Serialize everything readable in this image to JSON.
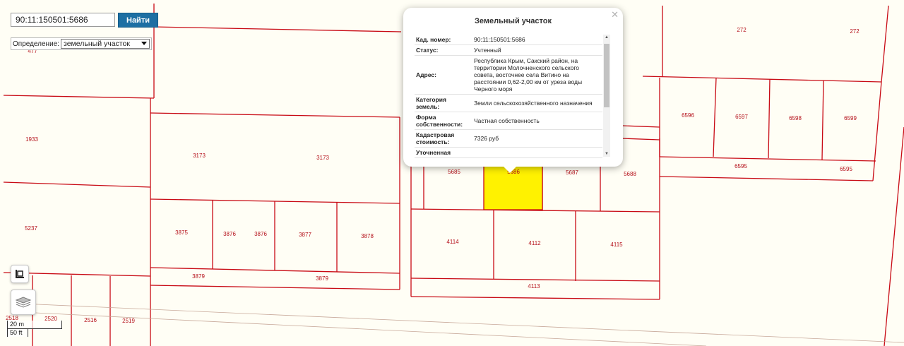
{
  "search": {
    "value": "90:11:150501:5686",
    "button_label": "Найти"
  },
  "determine": {
    "label": "Определение:",
    "selected": "земельный участок"
  },
  "map": {
    "background": "#fffef5",
    "line_color": "#c80a14",
    "selected_fill": "#fff200",
    "parcels": [
      "477",
      "1933",
      "5237",
      "3173",
      "3173",
      "3875",
      "3876",
      "3876",
      "3877",
      "3878",
      "3879",
      "3879",
      "2518",
      "2520",
      "2516",
      "2519",
      "5685",
      "5686",
      "5687",
      "5688",
      "4114",
      "4112",
      "4115",
      "4113",
      "272",
      "272",
      "6596",
      "6597",
      "6598",
      "6599",
      "6595",
      "6595"
    ],
    "selected_parcel": "5686"
  },
  "scale": {
    "metric": "20 m",
    "imperial": "50 ft"
  },
  "popup": {
    "title": "Земельный участок",
    "rows": [
      {
        "key": "Кад. номер:",
        "value": "90:11:150501:5686"
      },
      {
        "key": "Статус:",
        "value": "Учтенный"
      },
      {
        "key": "Адрес:",
        "value": "Республика Крым, Сакский район, на территории Молочненского сельского совета, восточнее села Витино на расстоянии 0,62-2,00 км от уреза воды Черного моря"
      },
      {
        "key": "Категория земель:",
        "value": "Земли сельскохозяйственного назначения"
      },
      {
        "key": "Форма собственности:",
        "value": "Частная собственность"
      },
      {
        "key": "Кадастровая стоимость:",
        "value": "7326 руб"
      },
      {
        "key": "Уточненная",
        "value": ""
      }
    ]
  },
  "icons": {
    "close": "close-icon",
    "layers": "layers-icon",
    "ruler": "ruler-icon"
  }
}
